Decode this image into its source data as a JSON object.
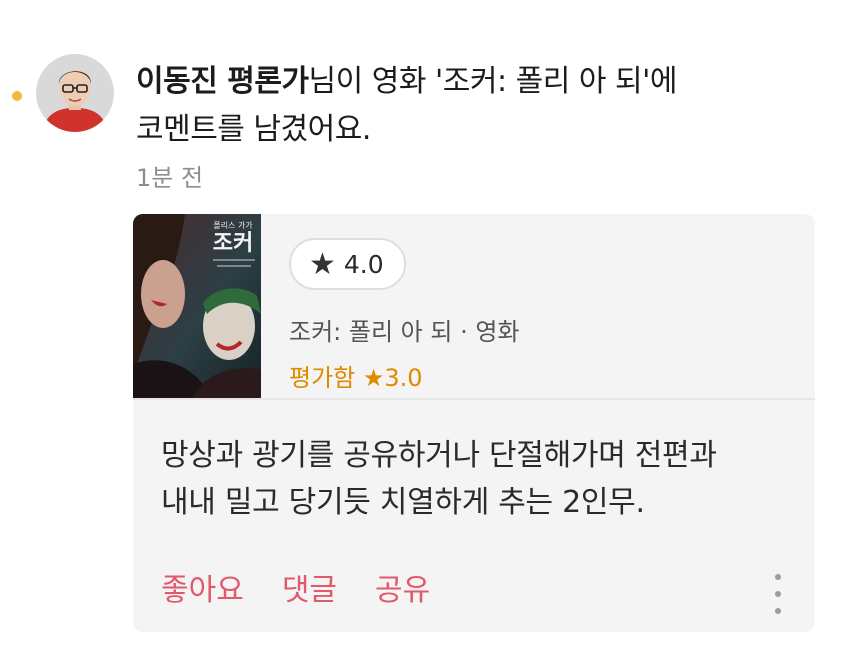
{
  "notification": {
    "author": "이동진 평론가",
    "message_line1_rest": "님이 영화 '조커: 폴리 아 되'에",
    "message_line2": "코멘트를 남겼어요.",
    "time": "1분 전",
    "unread_dot_color": "#f6b73c"
  },
  "card": {
    "poster": {
      "tagline": "폴리스   가가",
      "title": "조커"
    },
    "rating": {
      "icon": "star-icon",
      "star_glyph": "★",
      "value": "4.0"
    },
    "movie_line": "조커: 폴리 아 되 · 영화",
    "my_rating": "평가함 ★3.0",
    "comment_line1": "망상과 광기를 공유하거나 단절해가며 전편과",
    "comment_line2": "내내 밀고 당기듯 치열하게 추는 2인무.",
    "actions": {
      "like": "좋아요",
      "reply": "댓글",
      "share": "공유"
    },
    "more_icon": "more-vertical-icon",
    "accent_color": "#e2596c",
    "rating_color": "#e08a00"
  }
}
